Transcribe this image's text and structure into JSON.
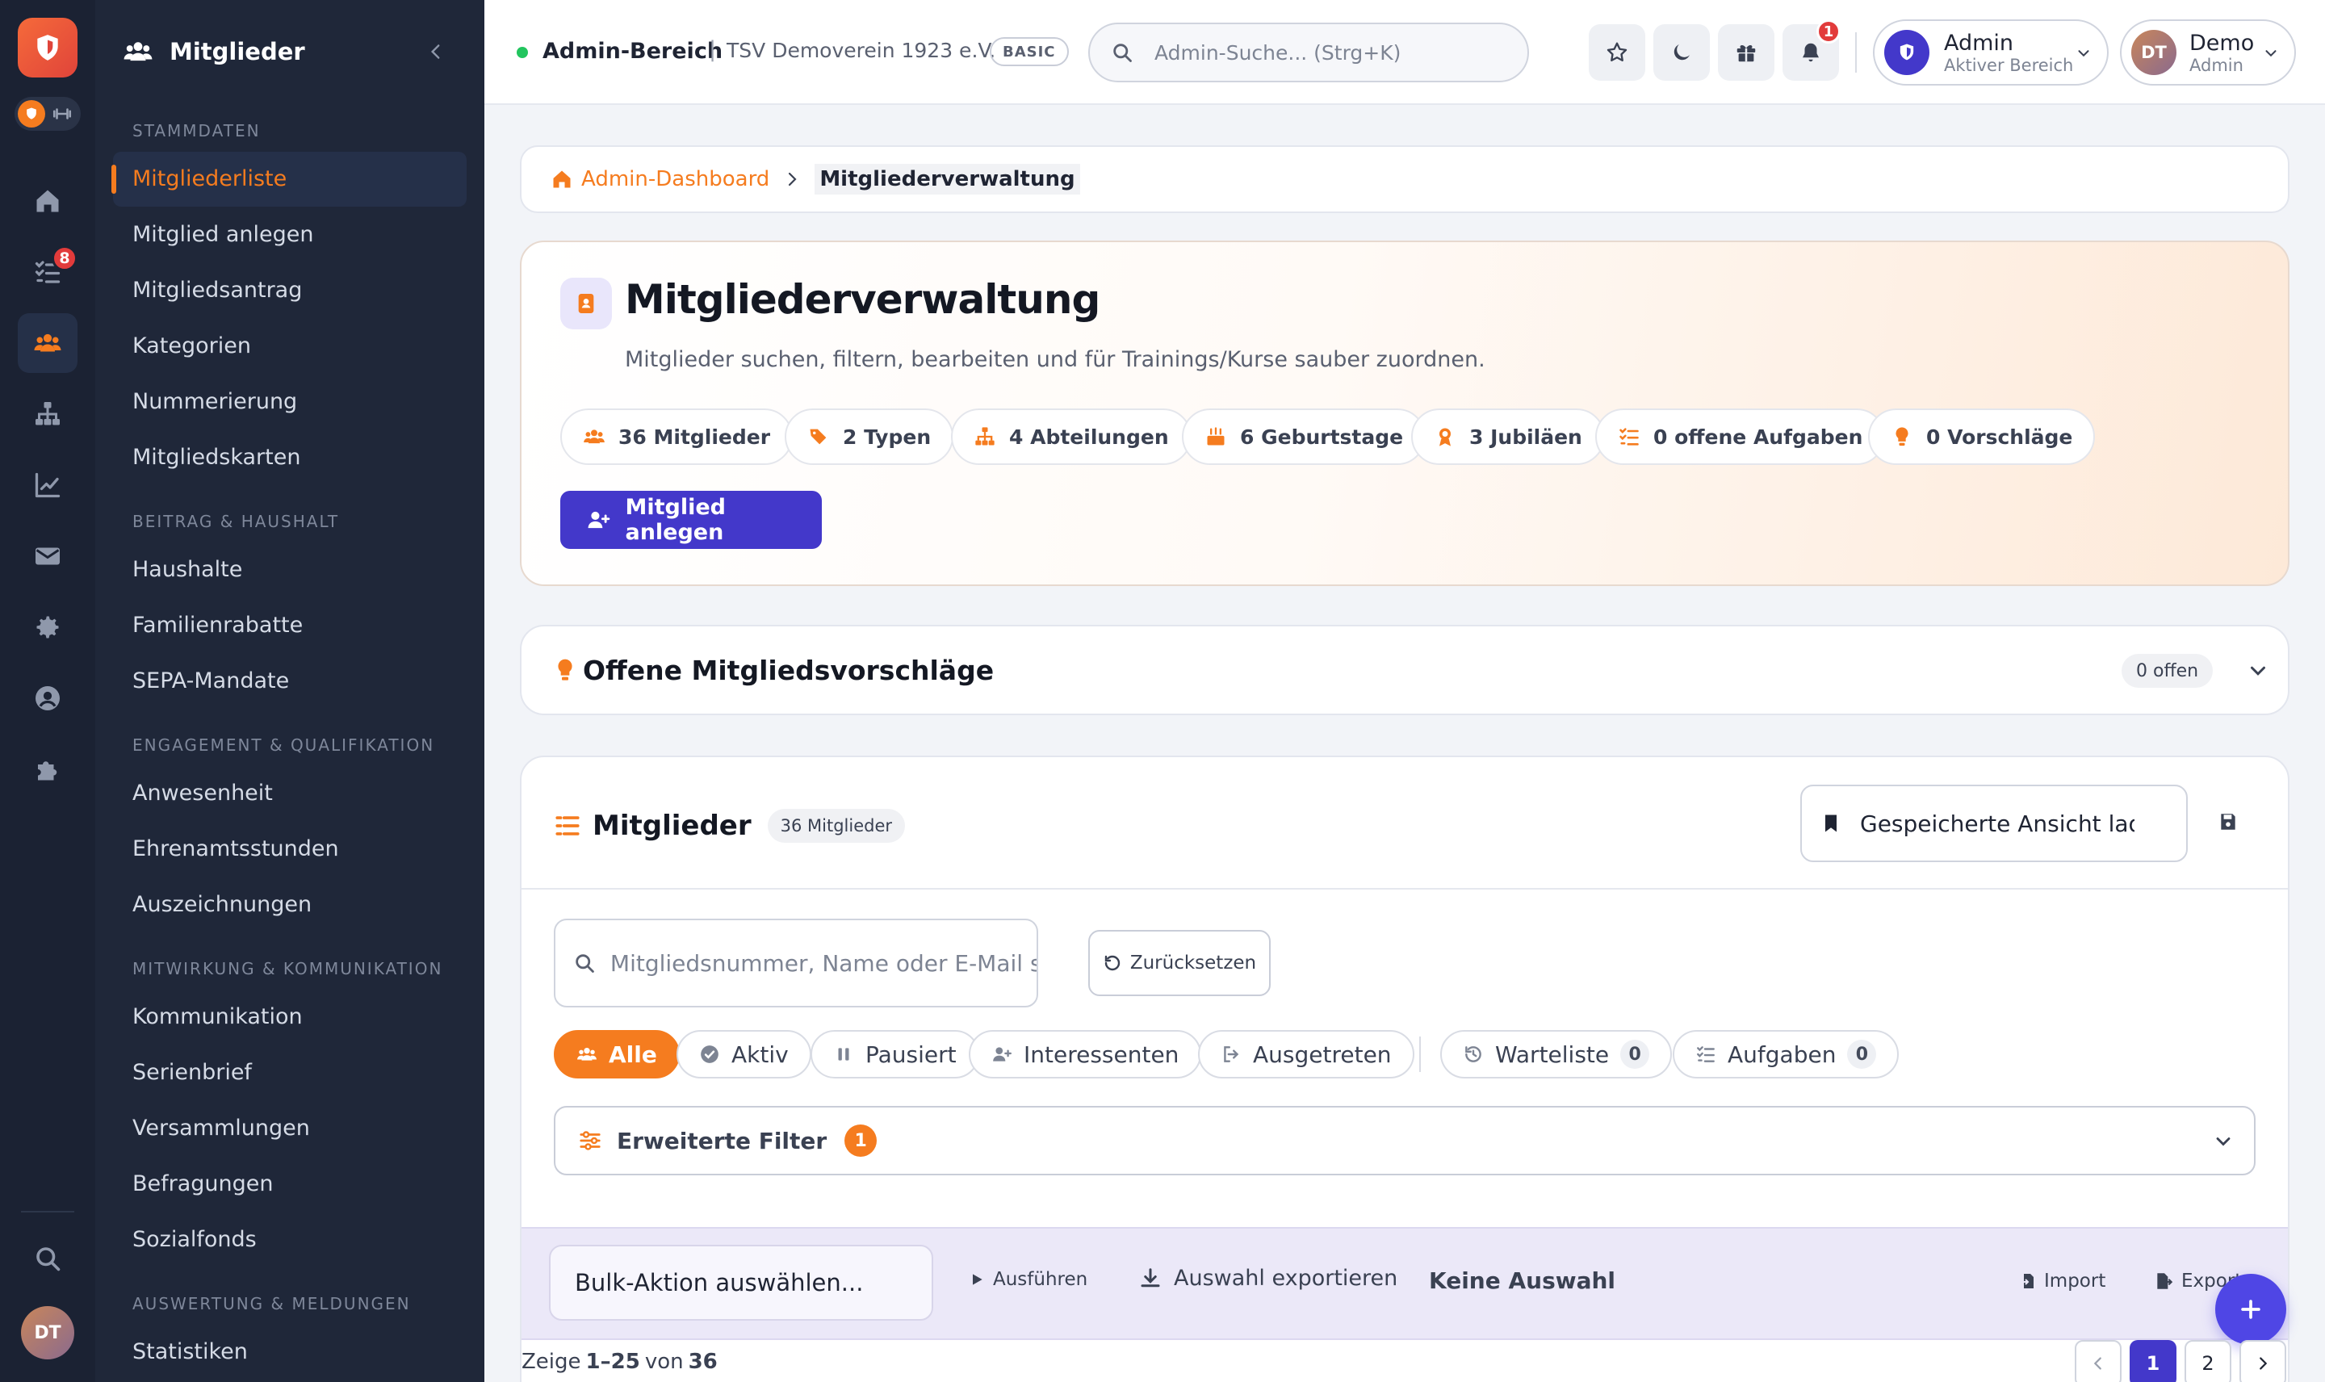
{
  "rail": {
    "notification_badge": "8",
    "avatar": "DT"
  },
  "sidebar": {
    "title": "Mitglieder",
    "sections": [
      {
        "label": "STAMMDATEN",
        "items": [
          "Mitgliederliste",
          "Mitglied anlegen",
          "Mitgliedsantrag",
          "Kategorien",
          "Nummerierung",
          "Mitgliedskarten"
        ]
      },
      {
        "label": "BEITRAG & HAUSHALT",
        "items": [
          "Haushalte",
          "Familienrabatte",
          "SEPA-Mandate"
        ]
      },
      {
        "label": "ENGAGEMENT & QUALIFIKATION",
        "items": [
          "Anwesenheit",
          "Ehrenamtsstunden",
          "Auszeichnungen"
        ]
      },
      {
        "label": "MITWIRKUNG & KOMMUNIKATION",
        "items": [
          "Kommunikation",
          "Serienbrief",
          "Versammlungen",
          "Befragungen",
          "Sozialfonds"
        ]
      },
      {
        "label": "AUSWERTUNG & MELDUNGEN",
        "items": [
          "Statistiken"
        ]
      }
    ],
    "active_item": "Mitgliederliste"
  },
  "topbar": {
    "area": "Admin-Bereich",
    "club": "TSV Demoverein 1923 e.V.",
    "plan": "BASIC",
    "search_placeholder": "Admin-Suche... (Strg+K)",
    "notif_count": "1",
    "role": {
      "title": "Admin",
      "subtitle": "Aktiver Bereich"
    },
    "user": {
      "initials": "DT",
      "name": "Demo",
      "role": "Admin"
    }
  },
  "breadcrumb": {
    "home": "Admin-Dashboard",
    "current": "Mitgliederverwaltung"
  },
  "hero": {
    "title": "Mitgliederverwaltung",
    "subtitle": "Mitglieder suchen, filtern, bearbeiten und für Trainings/Kurse sauber zuordnen.",
    "stats": [
      "36 Mitglieder",
      "2 Typen",
      "4 Abteilungen",
      "6 Geburtstage",
      "3 Jubiläen",
      "0 offene Aufgaben",
      "0 Vorschläge"
    ],
    "cta": "Mitglied anlegen"
  },
  "proposals": {
    "title": "Offene Mitgliedsvorschläge",
    "badge": "0 offen"
  },
  "members": {
    "title": "Mitglieder",
    "count_badge": "36 Mitglieder",
    "saved_view_placeholder": "Gespeicherte Ansicht laden",
    "search_placeholder": "Mitgliedsnummer, Name oder E-Mail suchen",
    "reset": "Zurücksetzen",
    "filters": {
      "all": "Alle",
      "active": "Aktiv",
      "paused": "Pausiert",
      "interested": "Interessenten",
      "left": "Ausgetreten",
      "waitlist": "Warteliste",
      "waitlist_count": "0",
      "tasks": "Aufgaben",
      "tasks_count": "0"
    },
    "advanced": {
      "label": "Erweiterte Filter",
      "count": "1"
    },
    "bulk": {
      "placeholder": "Bulk-Aktion auswählen...",
      "run": "Ausführen",
      "export_selection": "Auswahl exportieren",
      "no_selection": "Keine Auswahl",
      "import": "Import",
      "export": "Export"
    },
    "pagination": {
      "prefix": "Zeige",
      "range": "1–25",
      "of": "von",
      "total": "36",
      "pages": [
        "1",
        "2"
      ]
    }
  },
  "colors": {
    "accent": "#f57c1f",
    "primary": "#4338ca",
    "sidebar": "#1f2739",
    "rail": "#1b2233"
  }
}
